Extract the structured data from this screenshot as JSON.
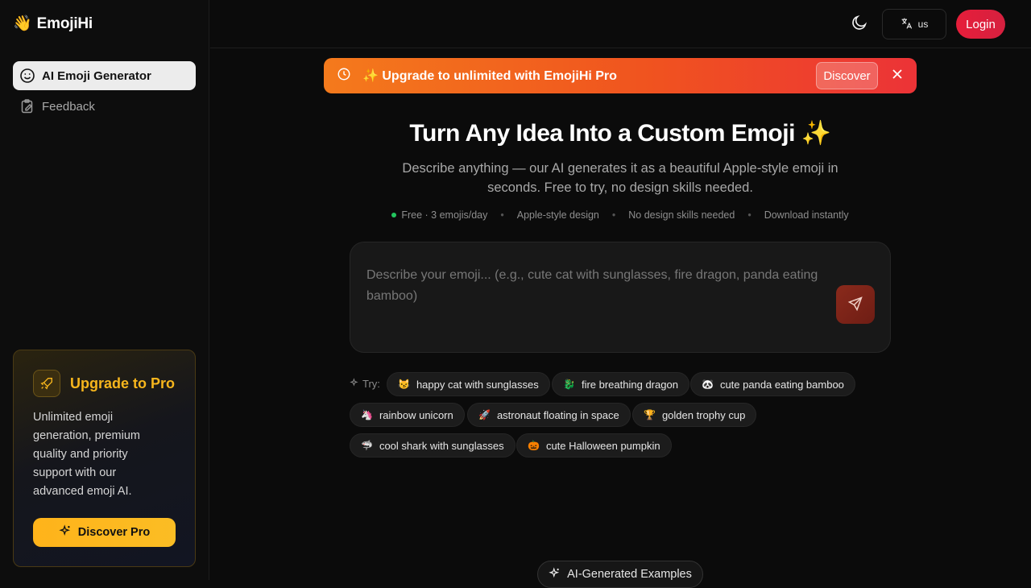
{
  "brand": {
    "icon": "👋",
    "name": "EmojiHi"
  },
  "sidebar": {
    "items": [
      {
        "label": "AI Emoji Generator",
        "icon": "smile-icon",
        "active": true
      },
      {
        "label": "Feedback",
        "icon": "clipboard-edit-icon",
        "active": false
      }
    ]
  },
  "promo": {
    "icon": "rocket-icon",
    "title": "Upgrade to Pro",
    "description": "Unlimited emoji generation, premium quality and priority support with our advanced emoji AI.",
    "button_label": "Discover Pro",
    "button_icon": "sparkles-icon",
    "accent": "#f7b61d"
  },
  "header": {
    "theme_icon": "moon-icon",
    "language": {
      "icon": "translate-icon",
      "label": "us"
    },
    "login_label": "Login"
  },
  "banner": {
    "icon": "clock-icon",
    "text": "✨ Upgrade to unlimited with EmojiHi Pro",
    "discover_label": "Discover",
    "close_icon": "close-icon"
  },
  "hero": {
    "title": "Turn Any Idea Into a Custom Emoji ✨",
    "subtitle": "Describe anything — our AI generates it as a beautiful Apple-style emoji in seconds. Free to try, no design skills needed.",
    "features": [
      "Free · 3 emojis/day",
      "Apple-style design",
      "No design skills needed",
      "Download instantly"
    ]
  },
  "prompt": {
    "placeholder": "Describe your emoji... (e.g., cute cat with sunglasses, fire dragon, panda eating bamboo)",
    "value": "",
    "send_icon": "send-icon"
  },
  "suggestions": {
    "label": "Try:",
    "chips": [
      {
        "emoji": "😼",
        "text": "happy cat with sunglasses"
      },
      {
        "emoji": "🐉",
        "text": "fire breathing dragon"
      },
      {
        "emoji": "🐼",
        "text": "cute panda eating bamboo"
      },
      {
        "emoji": "🦄",
        "text": "rainbow unicorn"
      },
      {
        "emoji": "🚀",
        "text": "astronaut floating in space"
      },
      {
        "emoji": "🏆",
        "text": "golden trophy cup"
      },
      {
        "emoji": "🦈",
        "text": "cool shark with sunglasses"
      },
      {
        "emoji": "🎃",
        "text": "cute Halloween pumpkin"
      }
    ]
  },
  "examples": {
    "label": "AI-Generated Examples",
    "icon": "sparkles-icon"
  }
}
